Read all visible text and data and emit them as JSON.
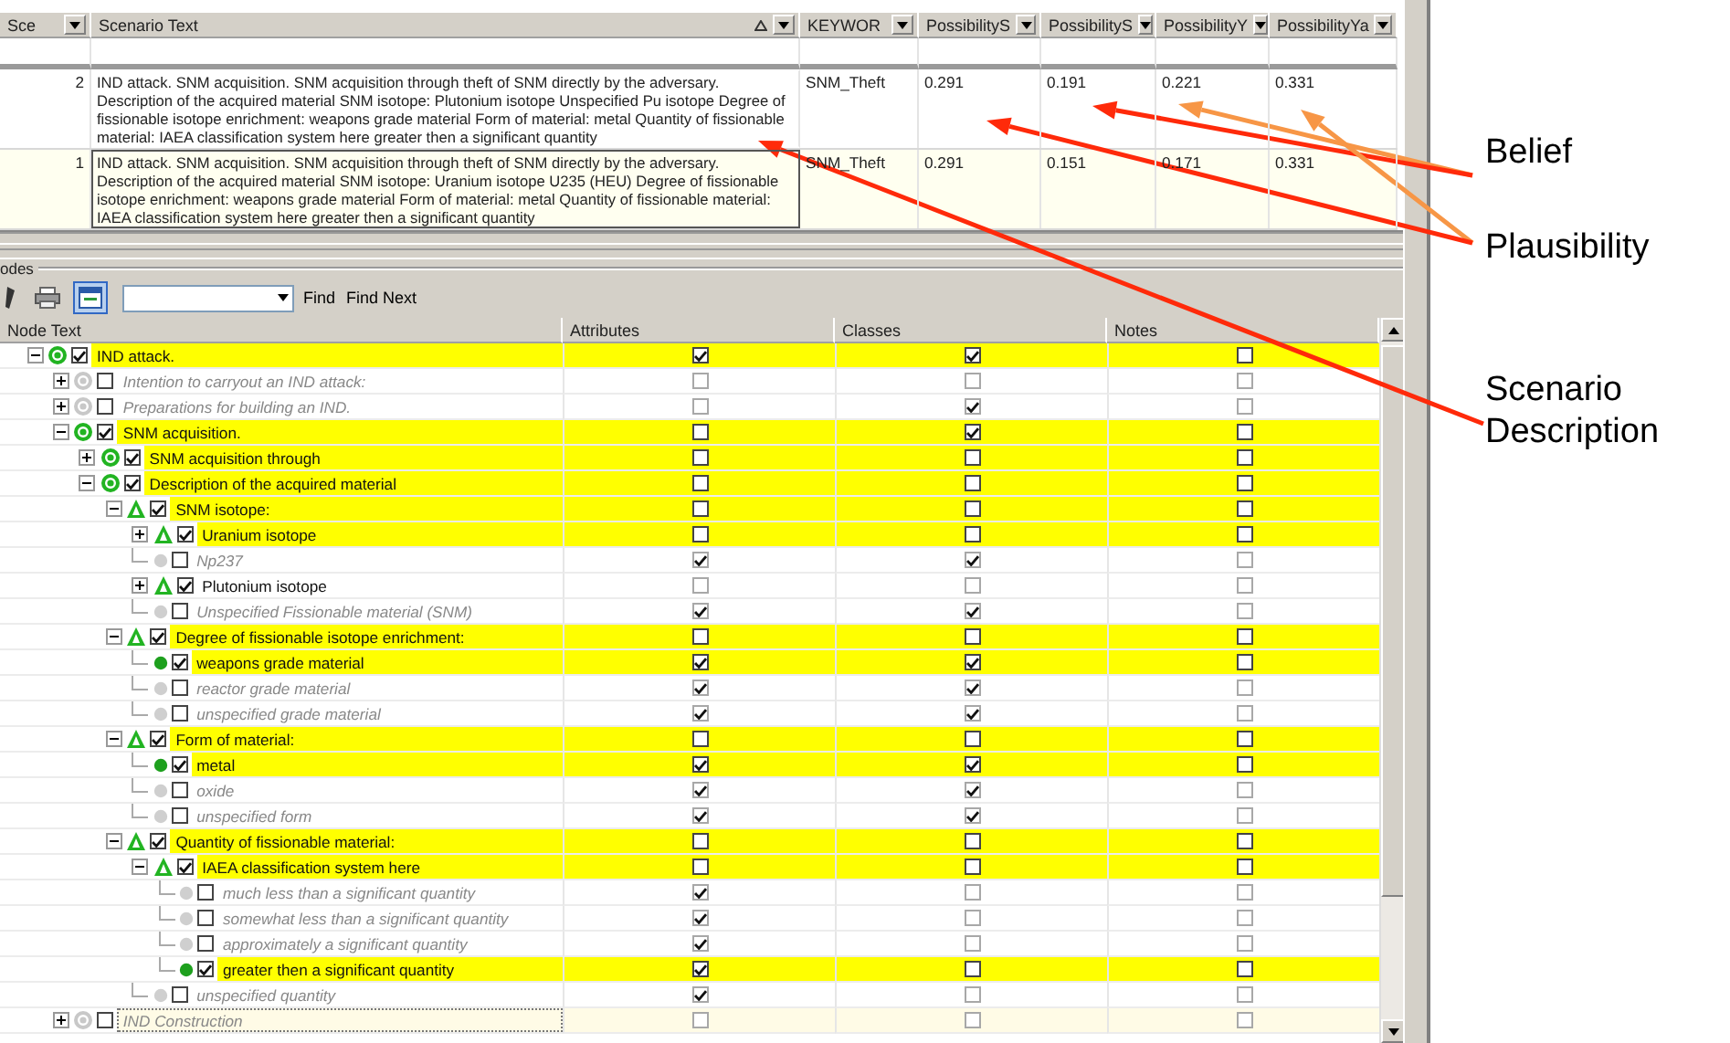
{
  "scenario_table": {
    "columns": [
      {
        "label": "Sce",
        "sorted": false
      },
      {
        "label": "Scenario Text",
        "sorted": true
      },
      {
        "label": "KEYWOR",
        "sorted": false
      },
      {
        "label": "PossibilityS",
        "sorted": false
      },
      {
        "label": "PossibilityS",
        "sorted": false
      },
      {
        "label": "PossibilityY",
        "sorted": false
      },
      {
        "label": "PossibilityYa",
        "sorted": false
      }
    ],
    "rows": [
      {
        "number": "2",
        "text": "IND attack. SNM acquisition. SNM acquisition through theft of SNM directly by the adversary. Description of the acquired material SNM isotope: Plutonium isotope Unspecified Pu isotope Degree of fissionable isotope enrichment: weapons grade material Form of material: metal Quantity of fissionable material: IAEA classification system here greater then a significant quantity",
        "keyword": "SNM_Theft",
        "values": [
          "0.291",
          "0.191",
          "0.221",
          "0.331"
        ],
        "selected": false
      },
      {
        "number": "1",
        "text": "IND attack. SNM acquisition. SNM acquisition through theft of SNM directly by the adversary. Description of the acquired material SNM isotope: Uranium isotope U235 (HEU) Degree of fissionable isotope enrichment: weapons grade material Form of material: metal Quantity of fissionable material: IAEA classification system here greater then a significant quantity",
        "keyword": "SNM_Theft",
        "values": [
          "0.291",
          "0.151",
          "0.171",
          "0.331"
        ],
        "selected": true
      }
    ]
  },
  "group_label": "odes",
  "toolbar": {
    "buttons": [
      {
        "kind": "edit",
        "pressed": false
      },
      {
        "kind": "print",
        "pressed": false
      },
      {
        "kind": "view",
        "pressed": true
      }
    ],
    "find_button": "Find",
    "find_next_button": "Find Next"
  },
  "tree": {
    "columns": [
      "Node Text",
      "Attributes",
      "Classes",
      "Notes"
    ],
    "nodes": [
      {
        "text": "IND attack.",
        "kind": "category",
        "checked": true,
        "highlighted": true,
        "selected": false,
        "expanded": true,
        "attributes": true,
        "classes": true,
        "notes": false,
        "children": [
          {
            "text": "Intention to carryout an IND attack:",
            "kind": "category",
            "checked": false,
            "highlighted": false,
            "selected": false,
            "expanded": false,
            "attributes": false,
            "classes": false,
            "notes": false
          },
          {
            "text": "Preparations for building an IND.",
            "kind": "category",
            "checked": false,
            "highlighted": false,
            "selected": false,
            "expanded": false,
            "attributes": false,
            "classes": true,
            "notes": false
          },
          {
            "text": "SNM acquisition.",
            "kind": "category",
            "checked": true,
            "highlighted": true,
            "selected": false,
            "expanded": true,
            "attributes": false,
            "classes": true,
            "notes": false,
            "children": [
              {
                "text": "SNM acquisition through",
                "kind": "category",
                "checked": true,
                "highlighted": true,
                "selected": false,
                "expanded": false,
                "attributes": false,
                "classes": false,
                "notes": false
              },
              {
                "text": "Description of the acquired material",
                "kind": "category",
                "checked": true,
                "highlighted": true,
                "selected": false,
                "expanded": true,
                "attributes": false,
                "classes": false,
                "notes": false,
                "children": [
                  {
                    "text": "SNM isotope:",
                    "kind": "attribute",
                    "checked": true,
                    "highlighted": true,
                    "selected": false,
                    "expanded": true,
                    "attributes": false,
                    "classes": false,
                    "notes": false,
                    "children": [
                      {
                        "text": "Uranium isotope",
                        "kind": "attribute",
                        "checked": true,
                        "highlighted": true,
                        "selected": false,
                        "expanded": false,
                        "attributes": false,
                        "classes": false,
                        "notes": false
                      },
                      {
                        "text": "Np237",
                        "kind": "value",
                        "checked": false,
                        "highlighted": false,
                        "selected": false,
                        "attributes": true,
                        "classes": true,
                        "notes": false
                      },
                      {
                        "text": "Plutonium isotope",
                        "kind": "attribute",
                        "checked": true,
                        "highlighted": false,
                        "selected": false,
                        "expanded": false,
                        "attributes": false,
                        "classes": false,
                        "notes": false
                      },
                      {
                        "text": "Unspecified Fissionable material (SNM)",
                        "kind": "value",
                        "checked": false,
                        "highlighted": false,
                        "selected": false,
                        "attributes": true,
                        "classes": true,
                        "notes": false
                      }
                    ]
                  },
                  {
                    "text": "Degree of fissionable isotope enrichment:",
                    "kind": "attribute",
                    "checked": true,
                    "highlighted": true,
                    "selected": false,
                    "expanded": true,
                    "attributes": false,
                    "classes": false,
                    "notes": false,
                    "children": [
                      {
                        "text": "weapons grade material",
                        "kind": "value",
                        "checked": true,
                        "highlighted": true,
                        "selected": false,
                        "attributes": true,
                        "classes": true,
                        "notes": false
                      },
                      {
                        "text": "reactor grade material",
                        "kind": "value",
                        "checked": false,
                        "highlighted": false,
                        "selected": false,
                        "attributes": true,
                        "classes": true,
                        "notes": false
                      },
                      {
                        "text": "unspecified grade material",
                        "kind": "value",
                        "checked": false,
                        "highlighted": false,
                        "selected": false,
                        "attributes": true,
                        "classes": true,
                        "notes": false
                      }
                    ]
                  },
                  {
                    "text": "Form of material:",
                    "kind": "attribute",
                    "checked": true,
                    "highlighted": true,
                    "selected": false,
                    "expanded": true,
                    "attributes": false,
                    "classes": false,
                    "notes": false,
                    "children": [
                      {
                        "text": "metal",
                        "kind": "value",
                        "checked": true,
                        "highlighted": true,
                        "selected": false,
                        "attributes": true,
                        "classes": true,
                        "notes": false
                      },
                      {
                        "text": "oxide",
                        "kind": "value",
                        "checked": false,
                        "highlighted": false,
                        "selected": false,
                        "attributes": true,
                        "classes": true,
                        "notes": false
                      },
                      {
                        "text": "unspecified form",
                        "kind": "value",
                        "checked": false,
                        "highlighted": false,
                        "selected": false,
                        "attributes": true,
                        "classes": true,
                        "notes": false
                      }
                    ]
                  },
                  {
                    "text": "Quantity of fissionable material:",
                    "kind": "attribute",
                    "checked": true,
                    "highlighted": true,
                    "selected": false,
                    "expanded": true,
                    "attributes": false,
                    "classes": false,
                    "notes": false,
                    "children": [
                      {
                        "text": "IAEA classification system here",
                        "kind": "attribute",
                        "checked": true,
                        "highlighted": true,
                        "selected": false,
                        "expanded": true,
                        "attributes": false,
                        "classes": false,
                        "notes": false,
                        "children": [
                          {
                            "text": "much less than a significant quantity",
                            "kind": "value",
                            "checked": false,
                            "highlighted": false,
                            "selected": false,
                            "attributes": true,
                            "classes": false,
                            "notes": false
                          },
                          {
                            "text": "somewhat less than a significant quantity",
                            "kind": "value",
                            "checked": false,
                            "highlighted": false,
                            "selected": false,
                            "attributes": true,
                            "classes": false,
                            "notes": false
                          },
                          {
                            "text": "approximately a significant quantity",
                            "kind": "value",
                            "checked": false,
                            "highlighted": false,
                            "selected": false,
                            "attributes": true,
                            "classes": false,
                            "notes": false
                          },
                          {
                            "text": "greater then a significant quantity",
                            "kind": "value",
                            "checked": true,
                            "highlighted": true,
                            "selected": false,
                            "attributes": true,
                            "classes": false,
                            "notes": false
                          }
                        ]
                      },
                      {
                        "text": "unspecified quantity",
                        "kind": "value",
                        "checked": false,
                        "highlighted": false,
                        "selected": false,
                        "attributes": true,
                        "classes": false,
                        "notes": false
                      }
                    ]
                  }
                ]
              }
            ]
          },
          {
            "text": "IND Construction",
            "kind": "category",
            "checked": false,
            "highlighted": false,
            "selected": true,
            "expanded": false,
            "attributes": false,
            "classes": false,
            "notes": false
          }
        ]
      }
    ]
  },
  "annotations": [
    {
      "text": "Belief"
    },
    {
      "text": "Plausibility"
    },
    {
      "text": "Scenario Description"
    }
  ]
}
